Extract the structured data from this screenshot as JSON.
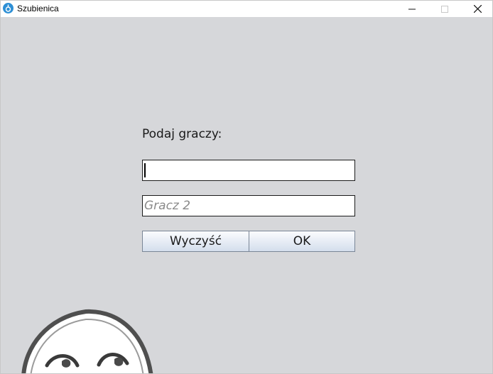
{
  "window": {
    "title": "Szubienica",
    "icon": "app-icon",
    "controls": [
      "minimize-icon",
      "maximize-icon",
      "close-icon"
    ]
  },
  "form": {
    "prompt": "Podaj graczy:",
    "player1_value": "",
    "player2_placeholder": "Gracz 2",
    "clear_label": "Wyczyść",
    "ok_label": "OK"
  },
  "colors": {
    "background": "#d6d7da",
    "field_border": "#1b1b1b",
    "button_border": "#7a8696"
  }
}
